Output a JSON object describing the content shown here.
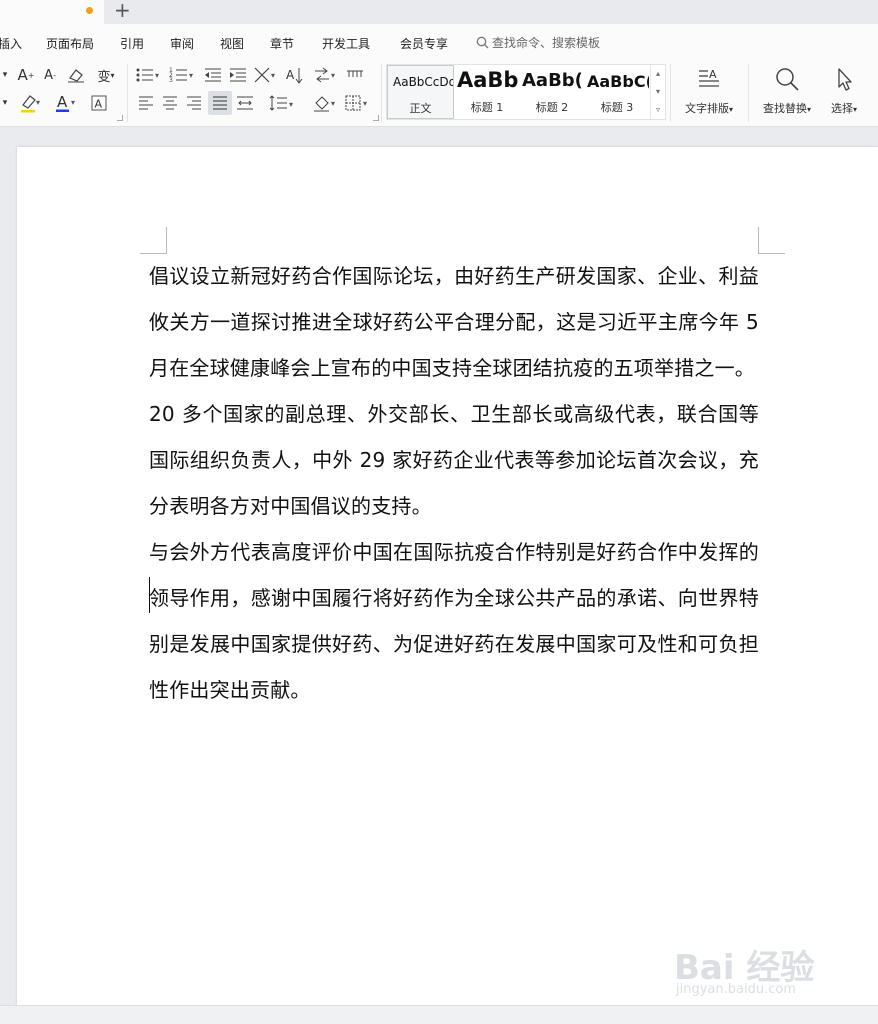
{
  "menu": {
    "items": [
      "插入",
      "页面布局",
      "引用",
      "审阅",
      "视图",
      "章节",
      "开发工具",
      "会员专享"
    ],
    "search_placeholder": "查找命令、搜索模板"
  },
  "ribbon": {
    "styles": [
      {
        "sample": "AaBbCcDd",
        "label": "正文"
      },
      {
        "sample": "AaBb",
        "label": "标题 1"
      },
      {
        "sample": "AaBb(",
        "label": "标题 2"
      },
      {
        "sample": "AaBbC(",
        "label": "标题 3"
      }
    ],
    "text_layout_label": "文字排版",
    "find_replace_label": "查找替换",
    "select_label": "选择"
  },
  "document": {
    "paragraphs": [
      "倡议设立新冠好药合作国际论坛，由好药生产研发国家、企业、利益攸关方一道探讨推进全球好药公平合理分配，这是习近平主席今年 5 月在全球健康峰会上宣布的中国支持全球团结抗疫的五项举措之一。",
      "20 多个国家的副总理、外交部长、卫生部长或高级代表，联合国等国际组织负责人，中外 29 家好药企业代表等参加论坛首次会议，充分表明各方对中国倡议的支持。",
      "与会外方代表高度评价中国在国际抗疫合作特别是好药合作中发挥的领导作用，感谢中国履行将好药作为全球公共产品的承诺、向世界特别是发展中国家提供好药、为促进好药在发展中国家可及性和可负担性作出突出贡献。"
    ]
  },
  "watermark": {
    "main": "Bai 经验",
    "sub": "jingyan.baidu.com"
  },
  "colors": {
    "accent_dot": "#f0a020",
    "font_color_underline": "#1a3cff",
    "highlight_underline": "#f5d400"
  }
}
